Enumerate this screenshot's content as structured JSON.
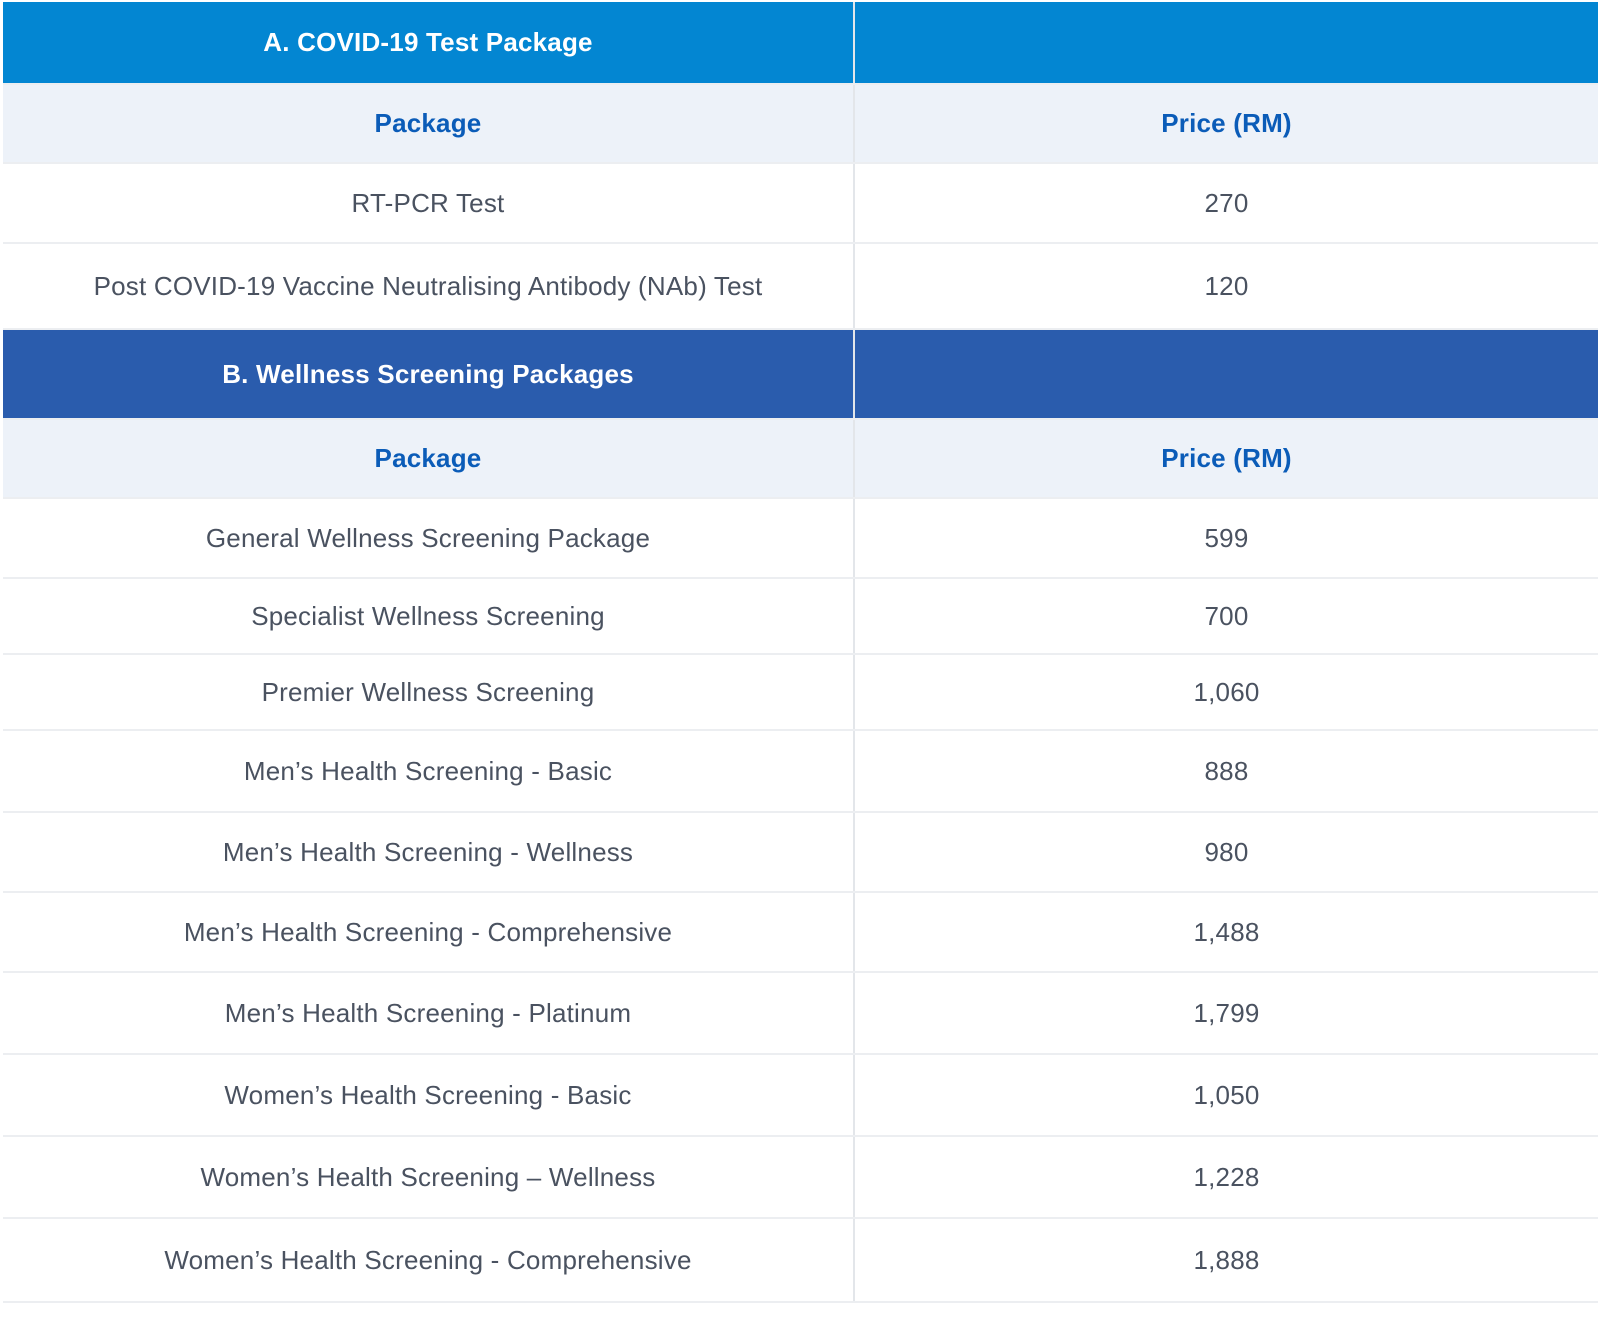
{
  "section_a": {
    "title": "A. COVID-19 Test Package",
    "columns": {
      "package": "Package",
      "price": "Price (RM)"
    },
    "rows": [
      {
        "package": "RT-PCR Test",
        "price": "270"
      },
      {
        "package": "Post COVID-19 Vaccine Neutralising Antibody (NAb) Test",
        "price": "120"
      }
    ]
  },
  "section_b": {
    "title": "B. Wellness Screening Packages",
    "columns": {
      "package": "Package",
      "price": "Price (RM)"
    },
    "rows": [
      {
        "package": "General Wellness Screening Package",
        "price": "599"
      },
      {
        "package": "Specialist Wellness Screening",
        "price": "700"
      },
      {
        "package": "Premier Wellness Screening",
        "price": "1,060"
      },
      {
        "package": "Men’s Health Screening - Basic",
        "price": "888"
      },
      {
        "package": "Men’s Health Screening - Wellness",
        "price": "980"
      },
      {
        "package": "Men’s Health Screening - Comprehensive",
        "price": "1,488"
      },
      {
        "package": "Men’s Health Screening - Platinum",
        "price": "1,799"
      },
      {
        "package": "Women’s Health Screening - Basic",
        "price": "1,050"
      },
      {
        "package": "Women’s Health Screening – Wellness",
        "price": "1,228"
      },
      {
        "package": "Women’s Health Screening - Comprehensive",
        "price": "1,888"
      }
    ]
  },
  "colors": {
    "section_a_header": "#0386d2",
    "section_b_header": "#2a5cad",
    "column_header_bg": "#edf2f9",
    "column_header_text": "#0b5cb8",
    "body_text": "#4a5260"
  }
}
